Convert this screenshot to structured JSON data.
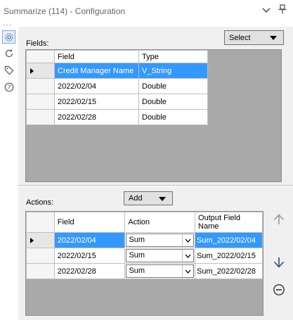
{
  "window": {
    "title": "Summarize (114) - Configuration"
  },
  "toolbar_icons": [
    "gear-icon",
    "refresh-icon",
    "tag-icon",
    "help-icon"
  ],
  "fields_section": {
    "label": "Fields:",
    "select_label": "Select",
    "columns": [
      "Field",
      "Type"
    ],
    "rows": [
      {
        "field": "Credit Manager Name",
        "type": "V_String",
        "selected": true
      },
      {
        "field": "2022/02/04",
        "type": "Double",
        "selected": false
      },
      {
        "field": "2022/02/15",
        "type": "Double",
        "selected": false
      },
      {
        "field": "2022/02/28",
        "type": "Double",
        "selected": false
      }
    ]
  },
  "actions_section": {
    "label": "Actions:",
    "add_label": "Add",
    "columns": [
      "Field",
      "Action",
      "Output Field Name"
    ],
    "rows": [
      {
        "field": "2022/02/04",
        "action": "Sum",
        "output": "Sum_2022/02/04",
        "selected": true
      },
      {
        "field": "2022/02/15",
        "action": "Sum",
        "output": "Sum_2022/02/15",
        "selected": false
      },
      {
        "field": "2022/02/28",
        "action": "Sum",
        "output": "Sum_2022/02/28",
        "selected": false
      }
    ]
  },
  "colors": {
    "selection": "#3399ff",
    "grid_background": "#a9a9a9",
    "panel_background": "#f0f0f0"
  }
}
